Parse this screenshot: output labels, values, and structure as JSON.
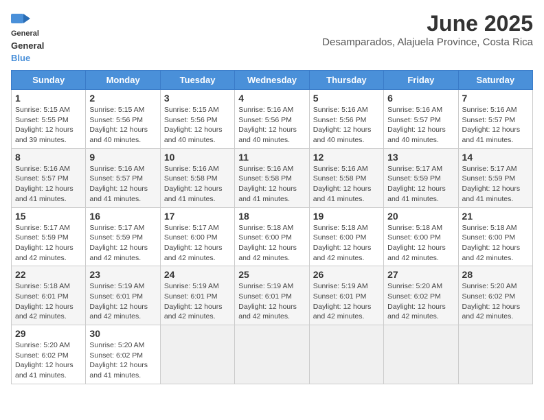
{
  "logo": {
    "line1": "General",
    "line2": "Blue"
  },
  "title": "June 2025",
  "subtitle": "Desamparados, Alajuela Province, Costa Rica",
  "weekdays": [
    "Sunday",
    "Monday",
    "Tuesday",
    "Wednesday",
    "Thursday",
    "Friday",
    "Saturday"
  ],
  "weeks": [
    [
      {
        "day": "1",
        "info": "Sunrise: 5:15 AM\nSunset: 5:55 PM\nDaylight: 12 hours\nand 39 minutes."
      },
      {
        "day": "2",
        "info": "Sunrise: 5:15 AM\nSunset: 5:56 PM\nDaylight: 12 hours\nand 40 minutes."
      },
      {
        "day": "3",
        "info": "Sunrise: 5:15 AM\nSunset: 5:56 PM\nDaylight: 12 hours\nand 40 minutes."
      },
      {
        "day": "4",
        "info": "Sunrise: 5:16 AM\nSunset: 5:56 PM\nDaylight: 12 hours\nand 40 minutes."
      },
      {
        "day": "5",
        "info": "Sunrise: 5:16 AM\nSunset: 5:56 PM\nDaylight: 12 hours\nand 40 minutes."
      },
      {
        "day": "6",
        "info": "Sunrise: 5:16 AM\nSunset: 5:57 PM\nDaylight: 12 hours\nand 40 minutes."
      },
      {
        "day": "7",
        "info": "Sunrise: 5:16 AM\nSunset: 5:57 PM\nDaylight: 12 hours\nand 41 minutes."
      }
    ],
    [
      {
        "day": "8",
        "info": "Sunrise: 5:16 AM\nSunset: 5:57 PM\nDaylight: 12 hours\nand 41 minutes."
      },
      {
        "day": "9",
        "info": "Sunrise: 5:16 AM\nSunset: 5:57 PM\nDaylight: 12 hours\nand 41 minutes."
      },
      {
        "day": "10",
        "info": "Sunrise: 5:16 AM\nSunset: 5:58 PM\nDaylight: 12 hours\nand 41 minutes."
      },
      {
        "day": "11",
        "info": "Sunrise: 5:16 AM\nSunset: 5:58 PM\nDaylight: 12 hours\nand 41 minutes."
      },
      {
        "day": "12",
        "info": "Sunrise: 5:16 AM\nSunset: 5:58 PM\nDaylight: 12 hours\nand 41 minutes."
      },
      {
        "day": "13",
        "info": "Sunrise: 5:17 AM\nSunset: 5:59 PM\nDaylight: 12 hours\nand 41 minutes."
      },
      {
        "day": "14",
        "info": "Sunrise: 5:17 AM\nSunset: 5:59 PM\nDaylight: 12 hours\nand 41 minutes."
      }
    ],
    [
      {
        "day": "15",
        "info": "Sunrise: 5:17 AM\nSunset: 5:59 PM\nDaylight: 12 hours\nand 42 minutes."
      },
      {
        "day": "16",
        "info": "Sunrise: 5:17 AM\nSunset: 5:59 PM\nDaylight: 12 hours\nand 42 minutes."
      },
      {
        "day": "17",
        "info": "Sunrise: 5:17 AM\nSunset: 6:00 PM\nDaylight: 12 hours\nand 42 minutes."
      },
      {
        "day": "18",
        "info": "Sunrise: 5:18 AM\nSunset: 6:00 PM\nDaylight: 12 hours\nand 42 minutes."
      },
      {
        "day": "19",
        "info": "Sunrise: 5:18 AM\nSunset: 6:00 PM\nDaylight: 12 hours\nand 42 minutes."
      },
      {
        "day": "20",
        "info": "Sunrise: 5:18 AM\nSunset: 6:00 PM\nDaylight: 12 hours\nand 42 minutes."
      },
      {
        "day": "21",
        "info": "Sunrise: 5:18 AM\nSunset: 6:00 PM\nDaylight: 12 hours\nand 42 minutes."
      }
    ],
    [
      {
        "day": "22",
        "info": "Sunrise: 5:18 AM\nSunset: 6:01 PM\nDaylight: 12 hours\nand 42 minutes."
      },
      {
        "day": "23",
        "info": "Sunrise: 5:19 AM\nSunset: 6:01 PM\nDaylight: 12 hours\nand 42 minutes."
      },
      {
        "day": "24",
        "info": "Sunrise: 5:19 AM\nSunset: 6:01 PM\nDaylight: 12 hours\nand 42 minutes."
      },
      {
        "day": "25",
        "info": "Sunrise: 5:19 AM\nSunset: 6:01 PM\nDaylight: 12 hours\nand 42 minutes."
      },
      {
        "day": "26",
        "info": "Sunrise: 5:19 AM\nSunset: 6:01 PM\nDaylight: 12 hours\nand 42 minutes."
      },
      {
        "day": "27",
        "info": "Sunrise: 5:20 AM\nSunset: 6:02 PM\nDaylight: 12 hours\nand 42 minutes."
      },
      {
        "day": "28",
        "info": "Sunrise: 5:20 AM\nSunset: 6:02 PM\nDaylight: 12 hours\nand 42 minutes."
      }
    ],
    [
      {
        "day": "29",
        "info": "Sunrise: 5:20 AM\nSunset: 6:02 PM\nDaylight: 12 hours\nand 41 minutes."
      },
      {
        "day": "30",
        "info": "Sunrise: 5:20 AM\nSunset: 6:02 PM\nDaylight: 12 hours\nand 41 minutes."
      },
      {
        "day": "",
        "info": ""
      },
      {
        "day": "",
        "info": ""
      },
      {
        "day": "",
        "info": ""
      },
      {
        "day": "",
        "info": ""
      },
      {
        "day": "",
        "info": ""
      }
    ]
  ]
}
